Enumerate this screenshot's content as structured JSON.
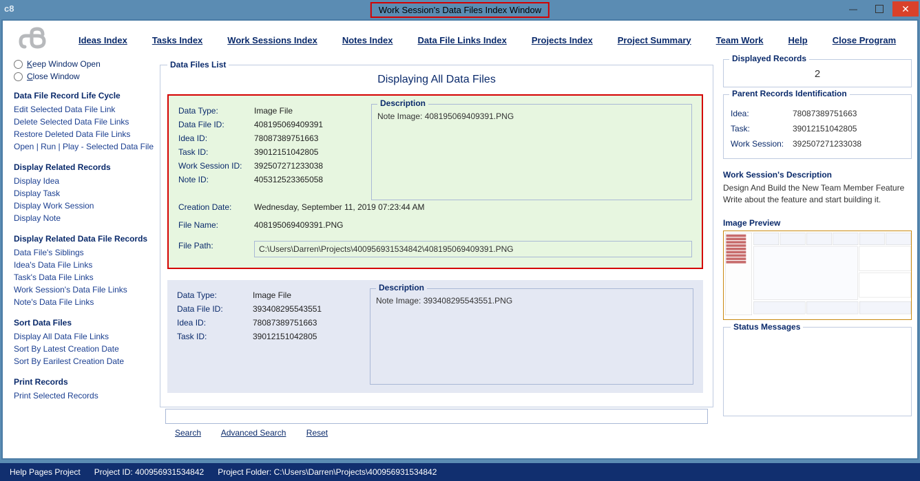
{
  "window": {
    "title": "Work Session's Data Files Index Window"
  },
  "menus": {
    "ideas": "Ideas Index",
    "tasks": "Tasks Index",
    "worksessions": "Work Sessions Index",
    "notes": "Notes Index",
    "datafiles": "Data File Links Index",
    "projects": "Projects Index",
    "summary": "Project Summary",
    "team": "Team Work",
    "help": "Help",
    "close": "Close Program"
  },
  "sidebar": {
    "keep_open_label": "Keep Window Open",
    "close_window_label": "Close Window",
    "life_head": "Data File Record Life Cycle",
    "life": {
      "edit": "Edit Selected Data File Link",
      "delete": "Delete Selected Data File Links",
      "restore": "Restore Deleted Data File Links",
      "open": "Open | Run | Play - Selected Data File"
    },
    "related_head": "Display Related Records",
    "related": {
      "idea": "Display Idea",
      "task": "Display Task",
      "ws": "Display Work Session",
      "note": "Display Note"
    },
    "dfr_head": "Display Related Data File Records",
    "dfr": {
      "siblings": "Data File's Siblings",
      "idea": "Idea's Data File Links",
      "task": "Task's Data File Links",
      "ws": "Work Session's Data File Links",
      "note": "Note's Data File Links"
    },
    "sort_head": "Sort Data Files",
    "sort": {
      "all": "Display All Data File Links",
      "latest": "Sort By Latest Creation Date",
      "earliest": "Sort By Earilest Creation Date"
    },
    "print_head": "Print Records",
    "print": {
      "selected": "Print Selected Records"
    }
  },
  "list": {
    "legend": "Data Files List",
    "heading": "Displaying All Data Files",
    "labels": {
      "datatype": "Data Type:",
      "datafileid": "Data File ID:",
      "ideaid": "Idea ID:",
      "taskid": "Task ID:",
      "wsid": "Work Session ID:",
      "noteid": "Note ID:",
      "created": "Creation Date:",
      "filename": "File Name:",
      "filepath": "File Path:",
      "description": "Description"
    },
    "items": [
      {
        "datatype": "Image File",
        "datafileid": "408195069409391",
        "ideaid": "78087389751663",
        "taskid": "39012151042805",
        "wsid": "392507271233038",
        "noteid": "405312523365058",
        "created": "Wednesday, September 11, 2019   07:23:44 AM",
        "filename": "408195069409391.PNG",
        "filepath": "C:\\Users\\Darren\\Projects\\400956931534842\\408195069409391.PNG",
        "description": "Note Image: 408195069409391.PNG"
      },
      {
        "datatype": "Image File",
        "datafileid": "393408295543551",
        "ideaid": "78087389751663",
        "taskid": "39012151042805",
        "description": "Note Image: 393408295543551.PNG"
      }
    ]
  },
  "search": {
    "search_label": "Search",
    "adv_label": "Advanced Search",
    "reset_label": "Reset"
  },
  "right": {
    "count_legend": "Displayed Records",
    "count": "2",
    "parent_legend": "Parent Records Identification",
    "parent": {
      "idea_label": "Idea:",
      "idea_val": "78087389751663",
      "task_label": "Task:",
      "task_val": "39012151042805",
      "ws_label": "Work Session:",
      "ws_val": "392507271233038"
    },
    "wsdesc_legend": "Work Session's Description",
    "wsdesc_text": "Design And Build the New Team Member Feature Write about the feature and start building it.",
    "preview_legend": "Image Preview",
    "status_legend": "Status Messages"
  },
  "statusbar": {
    "help": "Help Pages Project",
    "pid_label": "Project ID:",
    "pid": "400956931534842",
    "folder_label": "Project Folder:",
    "folder": "C:\\Users\\Darren\\Projects\\400956931534842"
  }
}
